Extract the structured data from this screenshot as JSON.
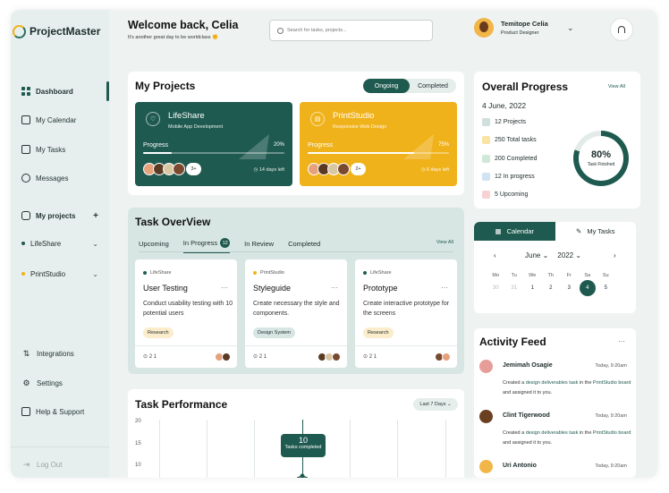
{
  "brand": {
    "name": "ProjectMaster"
  },
  "sidebar": {
    "nav": [
      {
        "label": "Dashboard",
        "icon": "dashboard-icon"
      },
      {
        "label": "My Calendar",
        "icon": "calendar-icon"
      },
      {
        "label": "My Tasks",
        "icon": "tasks-icon"
      },
      {
        "label": "Messages",
        "icon": "messages-icon"
      }
    ],
    "projects_label": "My projects",
    "projects": [
      {
        "label": "LifeShare",
        "color": "#1f5a50"
      },
      {
        "label": "PrintStudio",
        "color": "#f0b21b"
      }
    ],
    "bottom": [
      {
        "label": "Integrations"
      },
      {
        "label": "Settings"
      },
      {
        "label": "Help & Support"
      }
    ],
    "logout": "Log Out"
  },
  "header": {
    "welcome": "Welcome back, Celia",
    "subtitle": "It's another great day to be worldclass",
    "search_placeholder": "Search for tasks, projects...",
    "user_name": "Temitope Celia",
    "user_role": "Product Designer"
  },
  "my_projects": {
    "title": "My Projects",
    "toggle": [
      "Ongoing",
      "Completed"
    ],
    "cards": [
      {
        "name": "LifeShare",
        "sub": "Mobile App Development",
        "progress_label": "Progress",
        "progress": "20%",
        "progress_value": 0.2,
        "more": "3+",
        "days": "14 days left",
        "color": "#1f5a50"
      },
      {
        "name": "PrintStudio",
        "sub": "Responsive Web Design",
        "progress_label": "Progress",
        "progress": "75%",
        "progress_value": 0.75,
        "more": "2+",
        "days": "6 days left",
        "color": "#f0b21b"
      }
    ]
  },
  "overview": {
    "title": "Task OverView",
    "tabs": [
      "Upcoming",
      "In Progress",
      "In Review",
      "Completed"
    ],
    "badge": "12",
    "view_all": "View All",
    "tasks": [
      {
        "project": "LifeShare",
        "title": "User Testing",
        "desc": "Conduct usability testing with 10 potential users",
        "tag": "Research",
        "meta": "2  1",
        "dot": "#1f5a50",
        "tag_bg": "#fbeccb"
      },
      {
        "project": "PrintStudio",
        "title": "Styleguide",
        "desc": "Create necessary the style and components.",
        "tag": "Design System",
        "meta": "2  1",
        "dot": "#f0b21b",
        "tag_bg": "#d7e6e3"
      },
      {
        "project": "LifeShare",
        "title": "Prototype",
        "desc": "Create interactive prototype for the screens",
        "tag": "Research",
        "meta": "2  1",
        "dot": "#1f5a50",
        "tag_bg": "#fbeccb"
      }
    ]
  },
  "performance": {
    "title": "Task Performance",
    "filter": "Last 7 Days",
    "y_ticks": [
      "20",
      "15",
      "10"
    ],
    "tooltip_value": "10",
    "tooltip_label": "Tasks completed"
  },
  "overall": {
    "title": "Overall Progress",
    "view_all": "View All",
    "date": "4 June, 2022",
    "rows": [
      {
        "label": "12 Projects",
        "color": "#cfe0dc"
      },
      {
        "label": "250 Total tasks",
        "color": "#fbe3a4"
      },
      {
        "label": "200 Completed",
        "color": "#cfe8d7"
      },
      {
        "label": "12 In progress",
        "color": "#cfe3f3"
      },
      {
        "label": "5 Upcoming",
        "color": "#f8d2d2"
      }
    ],
    "ring_value": "80%",
    "ring_label": "Task Finished",
    "ring_fraction": 0.8
  },
  "calendar": {
    "tabs": [
      "Calendar",
      "My Tasks"
    ],
    "month": "June",
    "year": "2022",
    "weekdays": [
      "Mo",
      "Tu",
      "We",
      "Th",
      "Fr",
      "Sa",
      "Su"
    ],
    "days": [
      "30",
      "31",
      "1",
      "2",
      "3",
      "4",
      "5"
    ],
    "selected": "4"
  },
  "activity": {
    "title": "Activity Feed",
    "items": [
      {
        "name": "Jemimah Osagie",
        "time": "Today, 9:20am",
        "text_a": "Created a ",
        "link_a": "design deliverables task",
        "text_b": " in the ",
        "link_b": "PrintStudio board",
        "text_c": " and assigned it to you."
      },
      {
        "name": "Clint Tigerwood",
        "time": "Today, 9:20am",
        "text_a": "Created a ",
        "link_a": "design deliverables task",
        "text_b": " in the ",
        "link_b": "PrintStudio board",
        "text_c": " and assigned it to you."
      },
      {
        "name": "Uri Antonio",
        "time": "Today, 9:20am"
      }
    ]
  }
}
